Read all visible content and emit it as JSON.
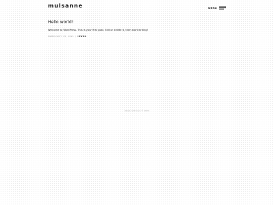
{
  "header": {
    "site_title": "mulsanne",
    "menu_label": "MENU",
    "menu_icon": "menu-lines-icon"
  },
  "post": {
    "title": "Hello world!",
    "content": "Welcome to WordPress. This is your first post. Edit or delete it, then start writing!",
    "date": "FEBRUARY 15, 2021",
    "separator": "|",
    "author": "IRWNE"
  },
  "footer": {
    "credit": "Made with love © 2024"
  },
  "colors": {
    "text": "#222222",
    "muted": "#9a9a9a",
    "background": "#ffffff"
  }
}
